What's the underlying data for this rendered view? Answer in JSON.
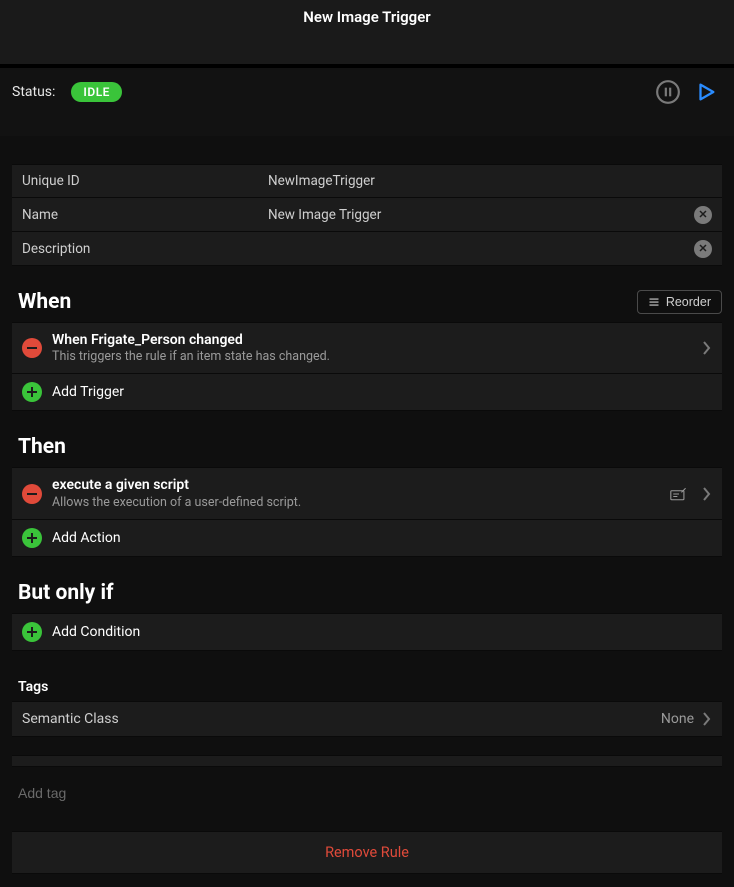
{
  "header": {
    "title": "New Image Trigger"
  },
  "status": {
    "label": "Status:",
    "badge": "IDLE"
  },
  "fields": {
    "uniqueId": {
      "label": "Unique ID",
      "value": "NewImageTrigger"
    },
    "name": {
      "label": "Name",
      "value": "New Image Trigger"
    },
    "description": {
      "label": "Description",
      "value": ""
    }
  },
  "reorder": {
    "label": "Reorder"
  },
  "sections": {
    "when": {
      "title": "When",
      "items": [
        {
          "title": "When Frigate_Person changed",
          "desc": "This triggers the rule if an item state has changed."
        }
      ],
      "add": "Add Trigger"
    },
    "then": {
      "title": "Then",
      "items": [
        {
          "title": "execute a given script",
          "desc": "Allows the execution of a user-defined script."
        }
      ],
      "add": "Add Action"
    },
    "butOnlyIf": {
      "title": "But only if",
      "add": "Add Condition"
    }
  },
  "tags": {
    "label": "Tags",
    "semanticClass": {
      "label": "Semantic Class",
      "value": "None"
    },
    "addPlaceholder": "Add tag"
  },
  "removeRule": "Remove Rule"
}
